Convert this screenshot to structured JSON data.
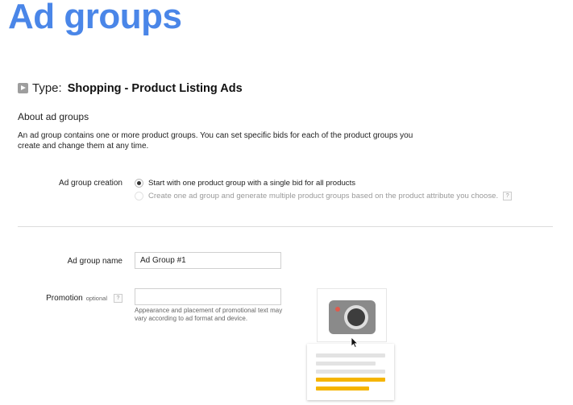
{
  "slide": {
    "title": "Ad groups"
  },
  "type_section": {
    "label": "Type:",
    "value": "Shopping - Product Listing Ads",
    "icon": "play-icon"
  },
  "about": {
    "heading": "About ad groups",
    "description": "An ad group contains one or more product groups. You can set specific bids for each of the product groups you create and change them at any time."
  },
  "ad_group_creation": {
    "label": "Ad group creation",
    "options": [
      {
        "label": "Start with one product group with a single bid for all products",
        "selected": true,
        "enabled": true
      },
      {
        "label": "Create one ad group and generate multiple product groups based on the product attribute you choose.",
        "selected": false,
        "enabled": false
      }
    ],
    "help": "?"
  },
  "ad_group_name": {
    "label": "Ad group name",
    "value": "Ad Group #1"
  },
  "promotion": {
    "label": "Promotion",
    "optional": "optional",
    "help": "?",
    "value": "",
    "note": "Appearance and placement of promotional text may vary according to ad format and device."
  },
  "preview": {
    "image_icon": "camera-icon",
    "cursor_icon": "arrow-cursor-icon"
  },
  "colors": {
    "title": "#4a86e8",
    "promo_bar": "#f5b400",
    "camera_dot": "#e05a4c"
  }
}
